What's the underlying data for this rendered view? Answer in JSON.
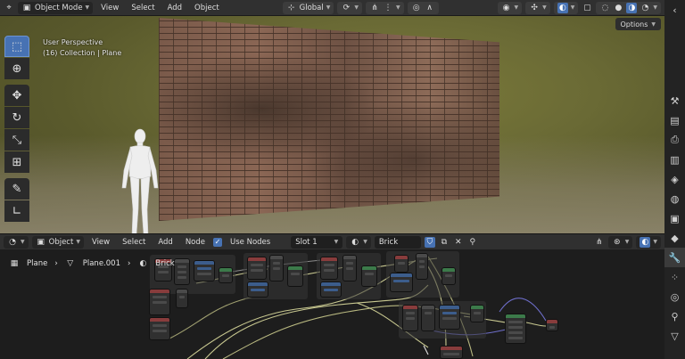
{
  "viewport_header": {
    "mode": "Object Mode",
    "menus": [
      "View",
      "Select",
      "Add",
      "Object"
    ],
    "orientation": "Global"
  },
  "viewport": {
    "perspective": "User Perspective",
    "collection": "(16) Collection | Plane",
    "options_label": "Options"
  },
  "node_header": {
    "editor_type": "Object",
    "menus": [
      "View",
      "Select",
      "Add",
      "Node"
    ],
    "use_nodes_label": "Use Nodes",
    "slot": "Slot 1",
    "material": "Brick"
  },
  "breadcrumb": {
    "object": "Plane",
    "mesh": "Plane.001",
    "material": "Brick"
  },
  "colors": {
    "accent": "#4772b3",
    "panel": "#303030",
    "node_bg": "#1d1d1d"
  }
}
